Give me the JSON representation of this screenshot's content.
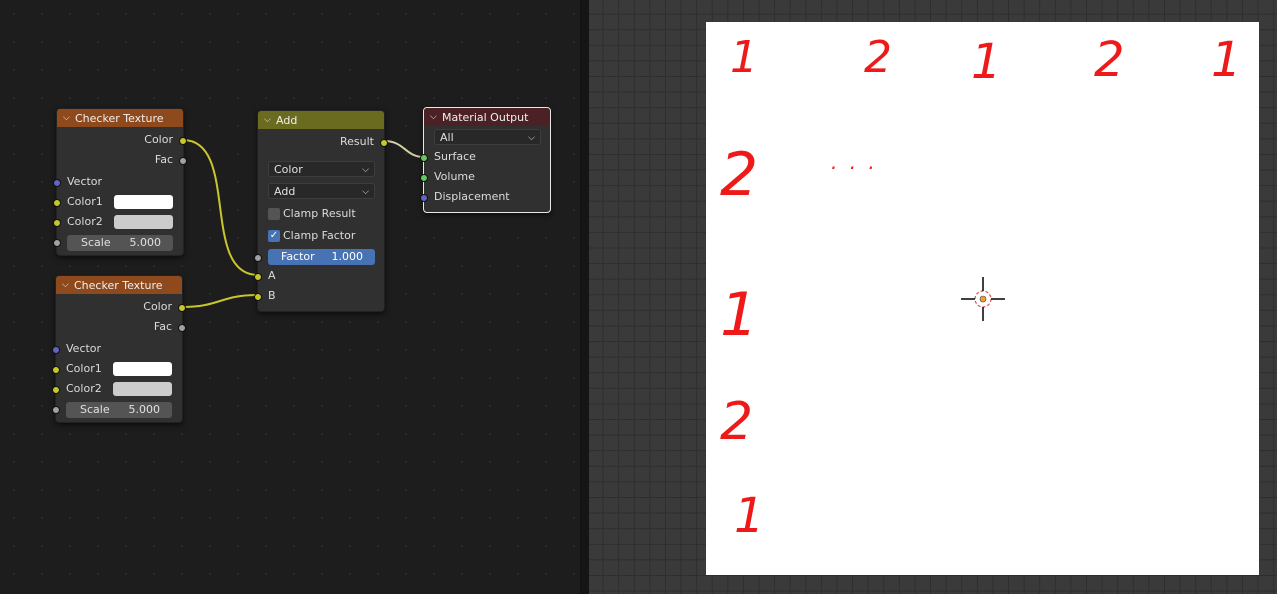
{
  "nodes": {
    "checker1": {
      "title": "Checker Texture",
      "outputs": [
        "Color",
        "Fac"
      ],
      "inputs": [
        "Vector",
        "Color1",
        "Color2"
      ],
      "scale_label": "Scale",
      "scale_value": "5.000",
      "color1": "#ffffff",
      "color2": "#cccccc",
      "header_color": "#8e4a1d"
    },
    "checker2": {
      "title": "Checker Texture",
      "outputs": [
        "Color",
        "Fac"
      ],
      "inputs": [
        "Vector",
        "Color1",
        "Color2"
      ],
      "scale_label": "Scale",
      "scale_value": "5.000",
      "color1": "#ffffff",
      "color2": "#cccccc",
      "header_color": "#8e4a1d"
    },
    "add": {
      "title": "Add",
      "output": "Result",
      "data_type": "Color",
      "blend": "Add",
      "clamp_result": "Clamp Result",
      "clamp_result_checked": false,
      "clamp_factor": "Clamp Factor",
      "clamp_factor_checked": true,
      "factor_label": "Factor",
      "factor_value": "1.000",
      "input_a": "A",
      "input_b": "B",
      "header_color": "#6b6b1f"
    },
    "output": {
      "title": "Material Output",
      "target": "All",
      "inputs": [
        "Surface",
        "Volume",
        "Displacement"
      ],
      "header_color": "#4b2125"
    }
  },
  "annotations": {
    "top": [
      "1",
      "2",
      "1",
      "2",
      "1"
    ],
    "left": [
      "2",
      "1",
      "2",
      "1"
    ],
    "dots": ". . ."
  },
  "colors": {
    "socket_color": "#c7c729",
    "socket_float": "#a1a1a1",
    "socket_vector": "#6363c7",
    "socket_shader": "#63c763",
    "annotation": "#ee1a1a"
  }
}
